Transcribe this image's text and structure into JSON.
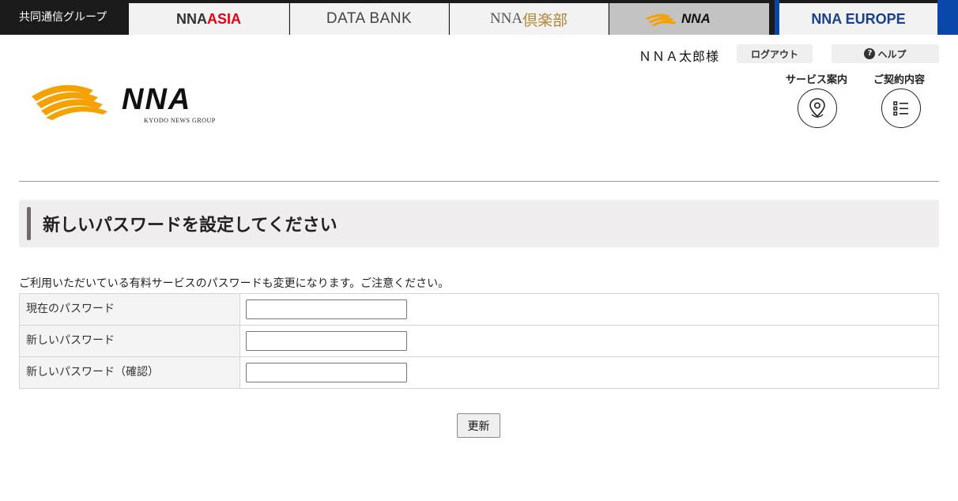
{
  "network": {
    "group_label": "共同通信グループ",
    "tabs": [
      {
        "label_main": "NNA ",
        "label_highlight": "ASIA"
      },
      {
        "label": "DATA BANK"
      },
      {
        "label_prefix": "NNA",
        "label_suffix": "倶楽部"
      },
      {
        "label": "NNA"
      },
      {
        "label": "NNA EUROPE"
      }
    ]
  },
  "header": {
    "user_name": "ＮＮＡ太郎様",
    "logout_label": "ログアウト",
    "help_label": "ヘルプ",
    "help_icon": "?",
    "service_label": "サービス案内",
    "contract_label": "ご契約内容",
    "logo_text": "NNA",
    "logo_subtext": "KYODO NEWS GROUP"
  },
  "page": {
    "title": "新しいパスワードを設定してください",
    "note": "ご利用いただいている有料サービスのパスワードも変更になります。ご注意ください。",
    "fields": [
      {
        "label": "現在のパスワード",
        "value": ""
      },
      {
        "label": "新しいパスワード",
        "value": ""
      },
      {
        "label": "新しいパスワード（確認）",
        "value": ""
      }
    ],
    "submit_label": "更新"
  },
  "colors": {
    "accent_red": "#e60012",
    "europe_blue": "#0b47a8",
    "logo_orange": "#f5a200"
  }
}
